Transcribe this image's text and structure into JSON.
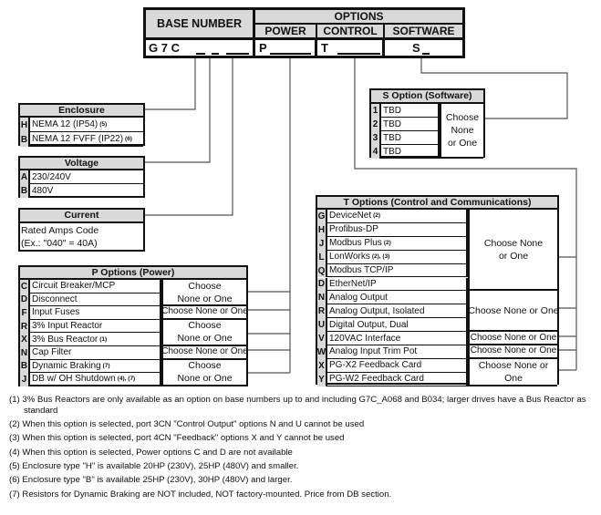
{
  "header": {
    "base_number": "BASE NUMBER",
    "options": "OPTIONS",
    "power": "POWER",
    "control": "CONTROL",
    "software": "SOFTWARE",
    "base_value": "G 7 C",
    "power_value": "P",
    "control_value": "T",
    "software_value": "S"
  },
  "enclosure": {
    "title": "Enclosure",
    "rows": [
      {
        "code": "H",
        "label": "NEMA 12 (IP54)",
        "note": "(5)"
      },
      {
        "code": "B",
        "label": "NEMA 12 FVFF (IP22)",
        "note": "(6)"
      }
    ]
  },
  "voltage": {
    "title": "Voltage",
    "rows": [
      {
        "code": "A",
        "label": "230/240V"
      },
      {
        "code": "B",
        "label": "480V"
      }
    ]
  },
  "current": {
    "title": "Current",
    "line1": "Rated Amps Code",
    "line2": "(Ex.: \"040\" = 40A)"
  },
  "s_options": {
    "title": "S Option (Software)",
    "rows": [
      {
        "code": "1",
        "label": "TBD"
      },
      {
        "code": "2",
        "label": "TBD"
      },
      {
        "code": "3",
        "label": "TBD"
      },
      {
        "code": "4",
        "label": "TBD"
      }
    ],
    "groups": [
      {
        "label": "Choose None or One"
      }
    ]
  },
  "p_options": {
    "title": "P Options (Power)",
    "rows": [
      {
        "code": "C",
        "label": "Circuit Breaker/MCP"
      },
      {
        "code": "D",
        "label": "Disconnect"
      },
      {
        "code": "F",
        "label": "Input Fuses"
      },
      {
        "code": "R",
        "label": "3% Input Reactor"
      },
      {
        "code": "X",
        "label": "3% Bus Reactor",
        "note": "(1)"
      },
      {
        "code": "N",
        "label": "Cap Filter"
      },
      {
        "code": "B",
        "label": "Dynamic Braking",
        "note": "(7)"
      },
      {
        "code": "J",
        "label": "DB w/ OH Shutdown",
        "note": "(4), (7)"
      }
    ],
    "groups": [
      {
        "label": "Choose None or One"
      },
      {
        "label": "Choose None or One"
      },
      {
        "label": "Choose None or One"
      },
      {
        "label": "Choose None or One"
      },
      {
        "label": "Choose None or One"
      }
    ]
  },
  "t_options": {
    "title": "T Options (Control and Communications)",
    "rows": [
      {
        "code": "G",
        "label": "DeviceNet",
        "note": "(2)"
      },
      {
        "code": "H",
        "label": "Profibus-DP"
      },
      {
        "code": "J",
        "label": "Modbus Plus",
        "note": "(2)"
      },
      {
        "code": "L",
        "label": "LonWorks",
        "note": "(2), (3)"
      },
      {
        "code": "Q",
        "label": "Modbus TCP/IP"
      },
      {
        "code": "D",
        "label": "EtherNet/IP"
      },
      {
        "code": "N",
        "label": "Analog Output"
      },
      {
        "code": "R",
        "label": "Analog Output, Isolated"
      },
      {
        "code": "U",
        "label": "Digital Output, Dual"
      },
      {
        "code": "V",
        "label": "120VAC Interface"
      },
      {
        "code": "W",
        "label": "Analog Input Trim Pot"
      },
      {
        "code": "X",
        "label": "PG-X2 Feedback Card"
      },
      {
        "code": "Y",
        "label": "PG-W2 Feedback Card"
      }
    ],
    "groups": [
      {
        "label": "Choose None or One"
      },
      {
        "label": "Choose None or One"
      },
      {
        "label": "Choose None or One"
      },
      {
        "label": "Choose None or One"
      },
      {
        "label": "Choose None or One"
      }
    ]
  },
  "footnotes": [
    "(1) 3% Bus Reactors are only available as an option on base numbers up to and including G7C_A068 and B034; larger drives have a Bus Reactor as standard",
    "(2) When this option is selected, port 3CN \"Control Output\" options N and U cannot be used",
    "(3) When this option is selected, port 4CN \"Feedback\" options X and Y cannot be used",
    "(4) When this option is selected, Power options C and D are not available",
    "(5) Enclosure type \"H\" is available 20HP (230V), 25HP (480V) and smaller.",
    "(6) Enclosure type \"B\" is available 25HP (230V), 30HP (480V) and larger.",
    "(7) Resistors for Dynamic Braking are NOT included, NOT factory-mounted. Price from DB section."
  ]
}
